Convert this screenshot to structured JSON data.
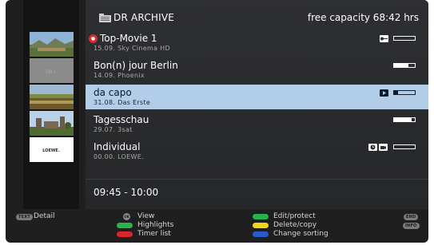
{
  "header": {
    "title": "DR ARCHIVE",
    "capacity": "free capacity 68:42 hrs"
  },
  "recordings": [
    {
      "title": "Top-Movie 1",
      "meta": "15.09.   Sky Cinema HD",
      "badge": "red-record",
      "progress": 0.0,
      "icons": [
        "key-icon"
      ]
    },
    {
      "title": "Bon(n) jour Berlin",
      "meta": "14.09.   Phoenix",
      "progress": 0.7,
      "icons": []
    },
    {
      "title": "da capo",
      "meta": "31.08.   Das Erste",
      "progress": 0.2,
      "icons": [
        "play-square-icon"
      ],
      "selected": true
    },
    {
      "title": "Tagesschau",
      "meta": "29.07.   3sat",
      "progress": 0.85,
      "icons": []
    },
    {
      "title": "Individual",
      "meta": "00.00.   LOEWE.",
      "progress": 0.0,
      "icons": [
        "clock-icon",
        "camera-icon"
      ]
    }
  ],
  "time_range": "09:45 - 10:00",
  "thumbnails": [
    {
      "name": "landscape-thumbnail"
    },
    {
      "name": "grey-thumbnail",
      "text": "DR+"
    },
    {
      "name": "field-thumbnail"
    },
    {
      "name": "castle-thumbnail"
    },
    {
      "name": "loewe-thumbnail",
      "text": "LOEWE."
    }
  ],
  "footer": {
    "text_key": "TEXT",
    "detail": "Detail",
    "ok_key": "OK",
    "view": "View",
    "highlights": "Highlights",
    "timer_list": "Timer list",
    "edit_protect": "Edit/protect",
    "delete_copy": "Delete/copy",
    "change_sorting": "Change sorting",
    "end_key": "END",
    "info_key": "INFO"
  },
  "colors": {
    "selection": "#b2cde8",
    "green": "#27b34a",
    "red": "#d9272e",
    "yellow": "#f2d21b",
    "blue": "#2a5cc8"
  }
}
